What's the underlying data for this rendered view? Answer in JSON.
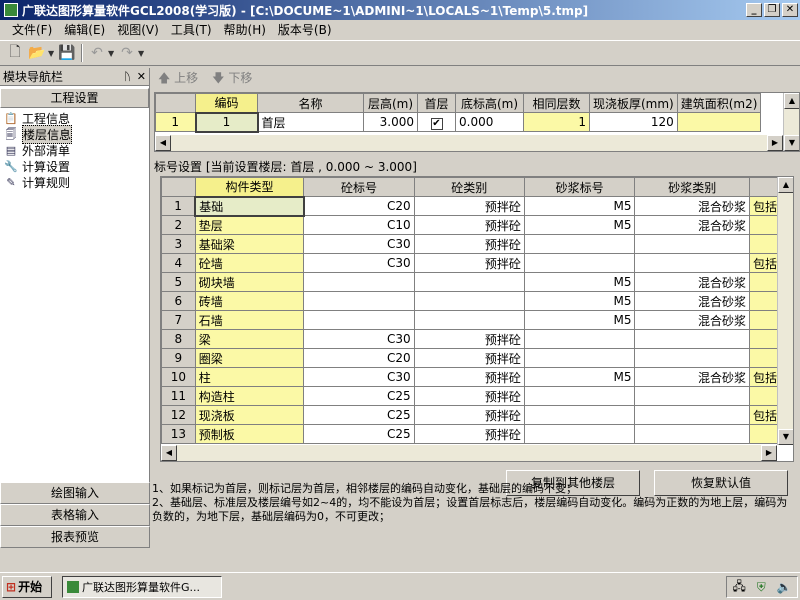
{
  "window": {
    "title": "广联达图形算量软件GCL2008(学习版) - [C:\\DOCUME~1\\ADMINI~1\\LOCALS~1\\Temp\\5.tmp]"
  },
  "menu": [
    "文件(F)",
    "编辑(E)",
    "视图(V)",
    "工具(T)",
    "帮助(H)",
    "版本号(B)"
  ],
  "nav": {
    "title": "模块导航栏",
    "section": "工程设置",
    "items": [
      {
        "label": "工程信息",
        "icon": "info-icon"
      },
      {
        "label": "楼层信息",
        "icon": "floors-icon"
      },
      {
        "label": "外部清单",
        "icon": "list-icon"
      },
      {
        "label": "计算设置",
        "icon": "calc-setting-icon"
      },
      {
        "label": "计算规则",
        "icon": "rules-icon"
      }
    ],
    "bottom": [
      "绘图输入",
      "表格输入",
      "报表预览"
    ]
  },
  "move": {
    "up": "上移",
    "down": "下移"
  },
  "floor_table": {
    "headers": [
      "编码",
      "名称",
      "层高(m)",
      "首层",
      "底标高(m)",
      "相同层数",
      "现浇板厚(mm)",
      "建筑面积(m2)"
    ],
    "rows": [
      {
        "num": "1",
        "code": "1",
        "name": "首层",
        "height": "3.000",
        "first": true,
        "base": "0.000",
        "same": "1",
        "slab": "120",
        "area": ""
      }
    ]
  },
  "grade": {
    "label": "标号设置 [当前设置楼层: 首层 , 0.000 ~ 3.000]",
    "headers": [
      "构件类型",
      "砼标号",
      "砼类别",
      "砂浆标号",
      "砂浆类别"
    ],
    "rows": [
      {
        "num": "1",
        "type": "基础",
        "concrete": "C20",
        "ccat": "预拌砼",
        "mortar": "M5",
        "mcat": "混合砂浆",
        "extra": "包括除"
      },
      {
        "num": "2",
        "type": "垫层",
        "concrete": "C10",
        "ccat": "预拌砼",
        "mortar": "M5",
        "mcat": "混合砂浆",
        "extra": ""
      },
      {
        "num": "3",
        "type": "基础梁",
        "concrete": "C30",
        "ccat": "预拌砼",
        "mortar": "",
        "mcat": "",
        "extra": ""
      },
      {
        "num": "4",
        "type": "砼墙",
        "concrete": "C30",
        "ccat": "预拌砼",
        "mortar": "",
        "mcat": "",
        "extra": "包括连"
      },
      {
        "num": "5",
        "type": "砌块墙",
        "concrete": "",
        "ccat": "",
        "mortar": "M5",
        "mcat": "混合砂浆",
        "extra": ""
      },
      {
        "num": "6",
        "type": "砖墙",
        "concrete": "",
        "ccat": "",
        "mortar": "M5",
        "mcat": "混合砂浆",
        "extra": ""
      },
      {
        "num": "7",
        "type": "石墙",
        "concrete": "",
        "ccat": "",
        "mortar": "M5",
        "mcat": "混合砂浆",
        "extra": ""
      },
      {
        "num": "8",
        "type": "梁",
        "concrete": "C30",
        "ccat": "预拌砼",
        "mortar": "",
        "mcat": "",
        "extra": ""
      },
      {
        "num": "9",
        "type": "圈梁",
        "concrete": "C20",
        "ccat": "预拌砼",
        "mortar": "",
        "mcat": "",
        "extra": ""
      },
      {
        "num": "10",
        "type": "柱",
        "concrete": "C30",
        "ccat": "预拌砼",
        "mortar": "M5",
        "mcat": "混合砂浆",
        "extra": "包括框"
      },
      {
        "num": "11",
        "type": "构造柱",
        "concrete": "C25",
        "ccat": "预拌砼",
        "mortar": "",
        "mcat": "",
        "extra": ""
      },
      {
        "num": "12",
        "type": "现浇板",
        "concrete": "C25",
        "ccat": "预拌砼",
        "mortar": "",
        "mcat": "",
        "extra": "包括螺"
      },
      {
        "num": "13",
        "type": "预制板",
        "concrete": "C25",
        "ccat": "预拌砼",
        "mortar": "",
        "mcat": "",
        "extra": ""
      }
    ]
  },
  "buttons": {
    "copy": "复制到其他楼层",
    "restore": "恢复默认值"
  },
  "notes": [
    "1、如果标记为首层，则标记层为首层，相邻楼层的编码自动变化，基础层的编码不变；",
    "2、基础层、标准层及楼层编号如2~4的，均不能设为首层；设置首层标志后，楼层编码自动变化。编码为正数的为地上层，编码为负数的，为地下层，基础层编码为0，不可更改；"
  ],
  "taskbar": {
    "start": "开始",
    "task": "广联达图形算量软件G..."
  }
}
